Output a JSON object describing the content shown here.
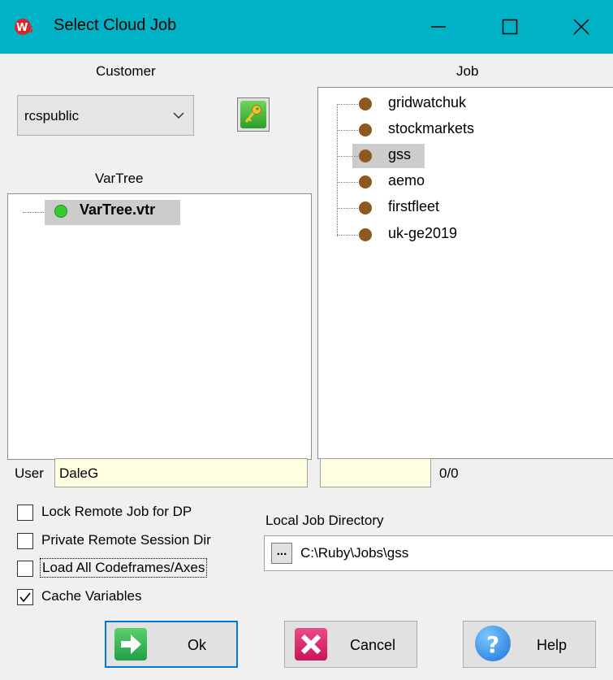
{
  "window": {
    "title": "Select Cloud Job",
    "icon": "wps-logo-icon",
    "controls": [
      "minimize-icon",
      "maximize-icon",
      "close-icon"
    ]
  },
  "customer": {
    "heading": "Customer",
    "selected": "rcspublic",
    "key_button_icon": "key-icon"
  },
  "vartree": {
    "heading": "VarTree",
    "items": [
      {
        "label": "VarTree.vtr",
        "status_color": "#33cc33",
        "selected": true
      }
    ]
  },
  "job": {
    "heading": "Job",
    "items": [
      {
        "label": "gridwatchuk",
        "selected": false
      },
      {
        "label": "stockmarkets",
        "selected": false
      },
      {
        "label": "gss",
        "selected": true
      },
      {
        "label": "aemo",
        "selected": false
      },
      {
        "label": "firstfleet",
        "selected": false
      },
      {
        "label": "uk-ge2019",
        "selected": false
      }
    ],
    "dot_color": "#8b5a22"
  },
  "user": {
    "label": "User",
    "value": "DaleG"
  },
  "counter": {
    "value": "",
    "text": "0/0"
  },
  "options": [
    {
      "label": "Lock Remote Job for DP",
      "checked": false
    },
    {
      "label": "Private Remote Session Dir",
      "checked": false
    },
    {
      "label": "Load All Codeframes/Axes",
      "checked": false,
      "focused": true
    },
    {
      "label": "Cache Variables",
      "checked": true
    }
  ],
  "local_dir": {
    "label": "Local Job Directory",
    "browse_label": "...",
    "value": "C:\\Ruby\\Jobs\\gss"
  },
  "buttons": {
    "ok": "Ok",
    "cancel": "Cancel",
    "help": "Help"
  },
  "colors": {
    "titlebar": "#00b2c6",
    "selection": "#cccccc",
    "field_bg": "#ffffe1",
    "default_border": "#0078d7"
  }
}
